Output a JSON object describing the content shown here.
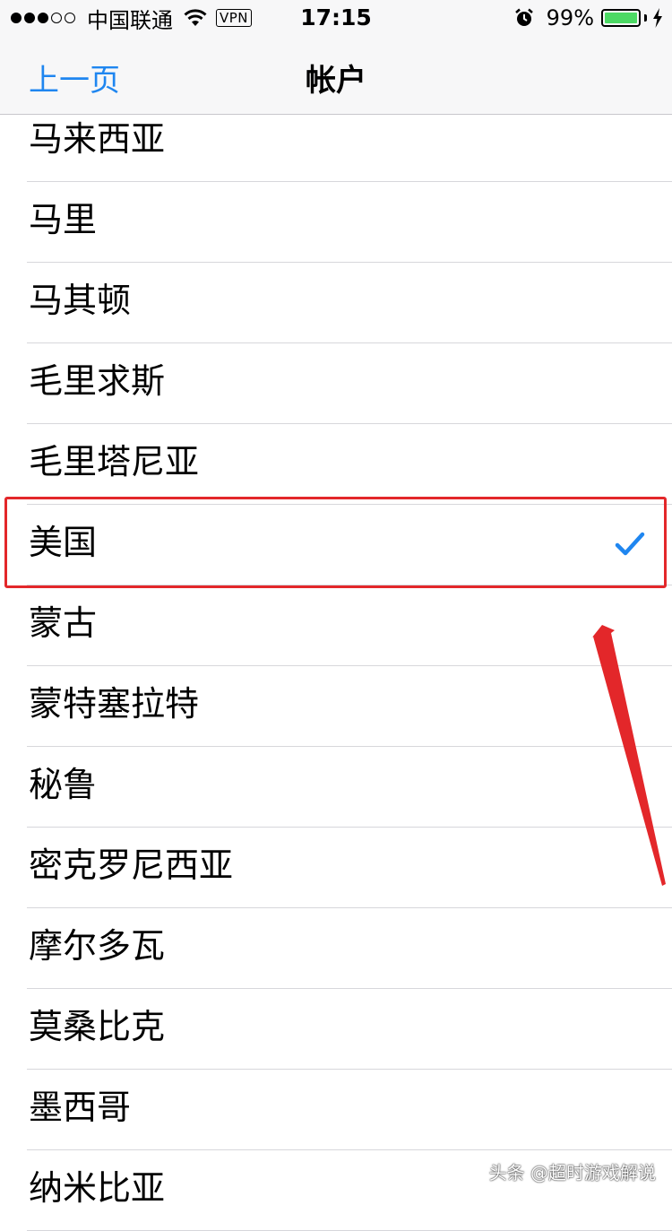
{
  "status_bar": {
    "carrier": "中国联通",
    "vpn": "VPN",
    "time": "17:15",
    "battery_percent": "99%",
    "battery_level": 0.99
  },
  "nav": {
    "back_label": "上一页",
    "title": "帐户"
  },
  "countries": [
    {
      "label": "马来西亚",
      "selected": false
    },
    {
      "label": "马里",
      "selected": false
    },
    {
      "label": "马其顿",
      "selected": false
    },
    {
      "label": "毛里求斯",
      "selected": false
    },
    {
      "label": "毛里塔尼亚",
      "selected": false
    },
    {
      "label": "美国",
      "selected": true
    },
    {
      "label": "蒙古",
      "selected": false
    },
    {
      "label": "蒙特塞拉特",
      "selected": false
    },
    {
      "label": "秘鲁",
      "selected": false
    },
    {
      "label": "密克罗尼西亚",
      "selected": false
    },
    {
      "label": "摩尔多瓦",
      "selected": false
    },
    {
      "label": "莫桑比克",
      "selected": false
    },
    {
      "label": "墨西哥",
      "selected": false
    },
    {
      "label": "纳米比亚",
      "selected": false
    }
  ],
  "watermark": "头条 @超时游戏解说",
  "colors": {
    "accent": "#1f86f0",
    "annotation": "#e3272a",
    "battery": "#4cd964"
  }
}
